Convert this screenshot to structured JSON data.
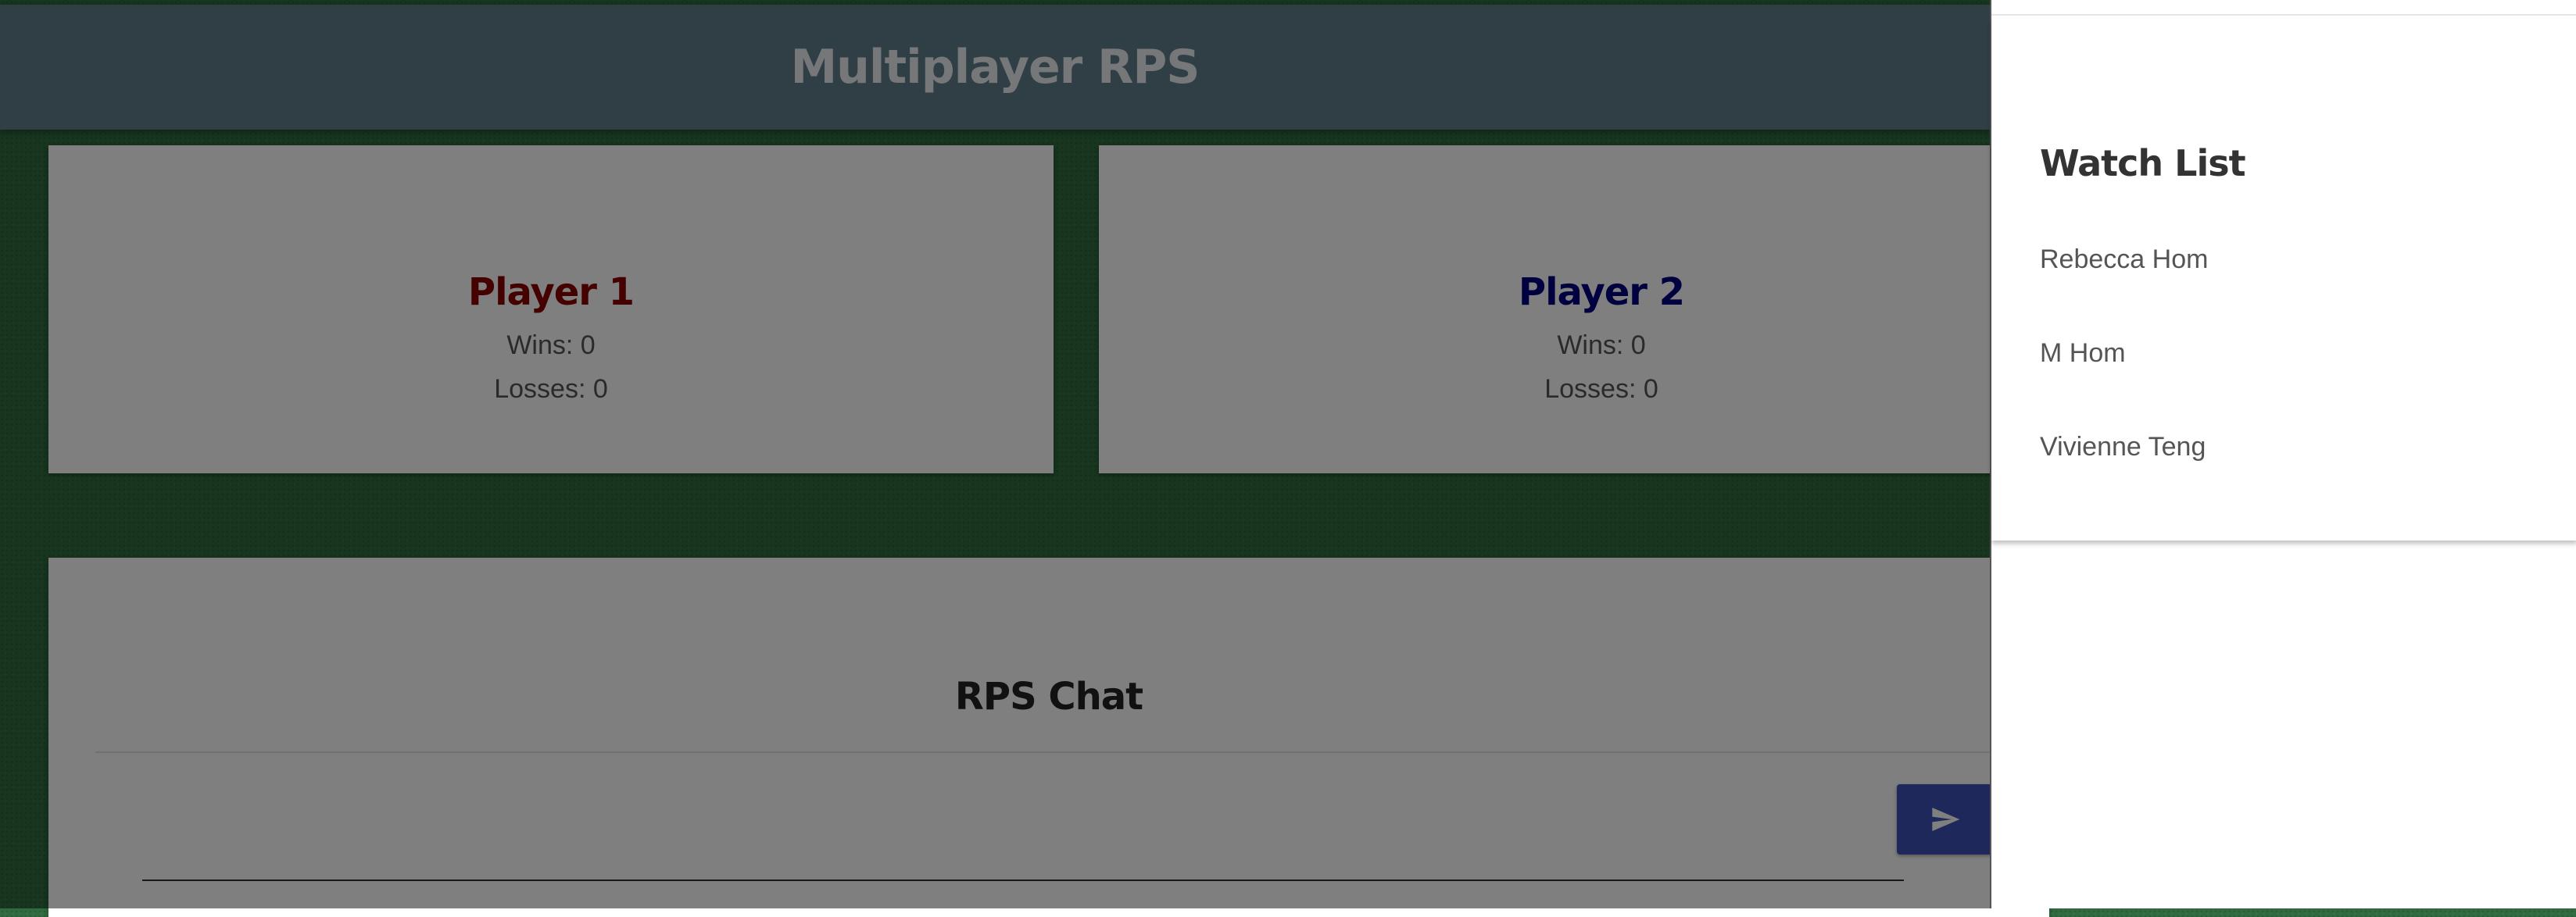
{
  "header": {
    "title": "Multiplayer RPS"
  },
  "players": [
    {
      "name": "Player 1",
      "name_color": "#8b0000",
      "wins_label": "Wins: 0",
      "losses_label": "Losses: 0"
    },
    {
      "name": "Player 2",
      "name_color": "#000080",
      "wins_label": "Wins: 0",
      "losses_label": "Losses: 0"
    }
  ],
  "chat": {
    "title": "RPS Chat",
    "input_value": "",
    "send_icon": "send-icon"
  },
  "watch_list": {
    "title": "Watch List",
    "items": [
      "Rebecca Hom",
      "M Hom",
      "Vivienne Teng"
    ]
  },
  "colors": {
    "header_bg": "#607d8b",
    "background": "#2f6b3f",
    "send_button": "#3f51b5"
  }
}
